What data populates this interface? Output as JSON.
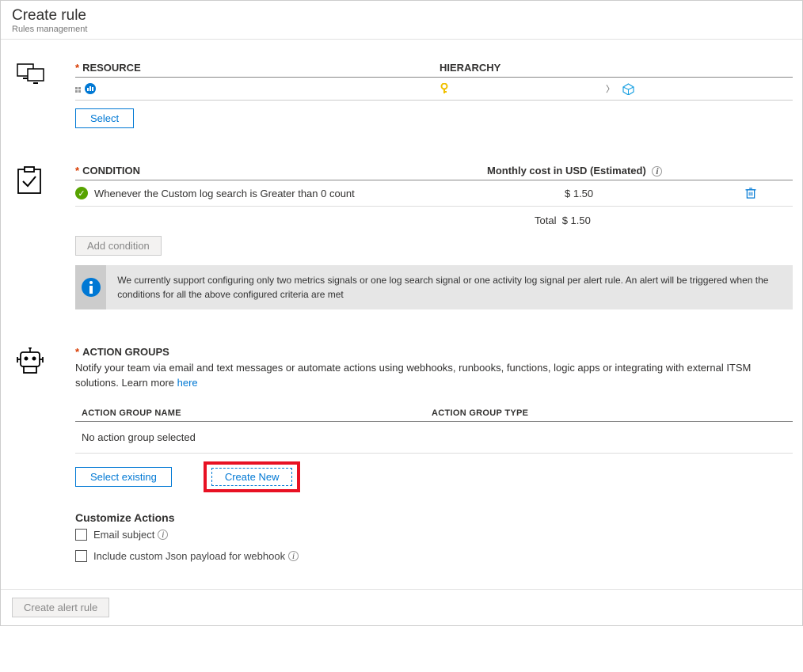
{
  "header": {
    "title": "Create rule",
    "subtitle": "Rules management"
  },
  "resource": {
    "label": "RESOURCE",
    "hierarchyLabel": "HIERARCHY",
    "selectBtn": "Select"
  },
  "condition": {
    "label": "CONDITION",
    "costLabel": "Monthly cost in USD (Estimated)",
    "row1Text": "Whenever the Custom log search is Greater than 0 count",
    "row1Cost": "$ 1.50",
    "totalLabel": "Total",
    "totalCost": "$ 1.50",
    "addBtn": "Add condition",
    "infoText": "We currently support configuring only two metrics signals or one log search signal or one activity log signal per alert rule. An alert will be triggered when the conditions for all the above configured criteria are met"
  },
  "actionGroups": {
    "label": "ACTION GROUPS",
    "desc": "Notify your team via email and text messages or automate actions using webhooks, runbooks, functions, logic apps or integrating with external ITSM solutions. Learn more ",
    "learnMore": "here",
    "col1": "ACTION GROUP NAME",
    "col2": "ACTION GROUP TYPE",
    "emptyText": "No action group selected",
    "selectExisting": "Select existing",
    "createNew": "Create New",
    "customizeTitle": "Customize Actions",
    "emailSubject": "Email subject",
    "jsonPayload": "Include custom Json payload for webhook"
  },
  "footer": {
    "createBtn": "Create alert rule"
  }
}
